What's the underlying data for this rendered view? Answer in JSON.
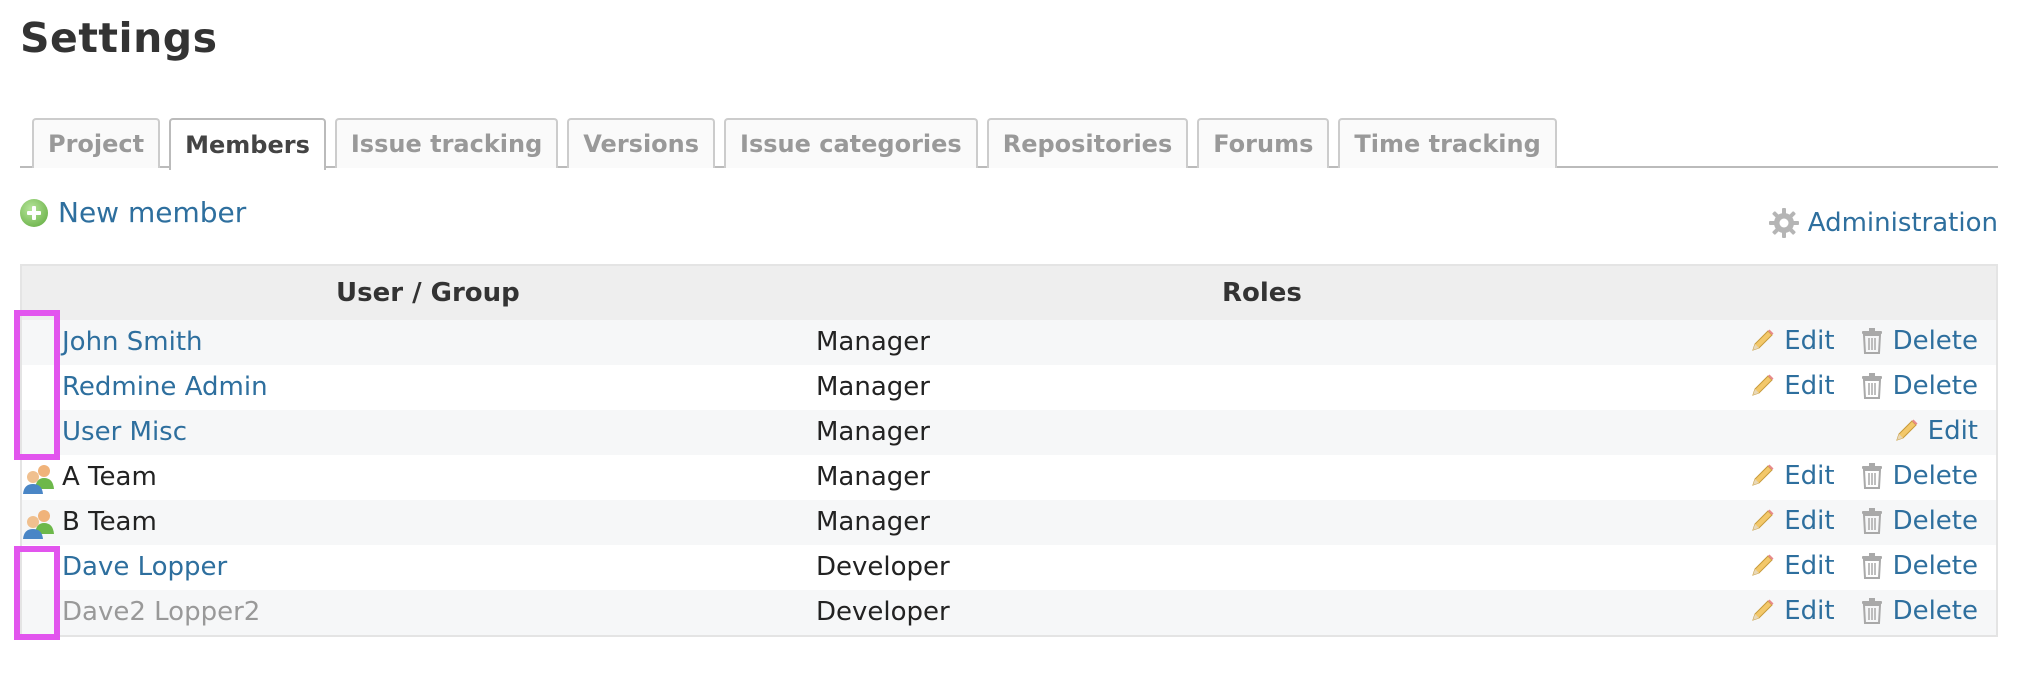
{
  "page": {
    "title": "Settings"
  },
  "tabs": [
    {
      "label": "Project",
      "selected": false
    },
    {
      "label": "Members",
      "selected": true
    },
    {
      "label": "Issue tracking",
      "selected": false
    },
    {
      "label": "Versions",
      "selected": false
    },
    {
      "label": "Issue categories",
      "selected": false
    },
    {
      "label": "Repositories",
      "selected": false
    },
    {
      "label": "Forums",
      "selected": false
    },
    {
      "label": "Time tracking",
      "selected": false
    }
  ],
  "actions_bar": {
    "new_member_label": "New member",
    "new_member_icon": "plus-circle-icon",
    "administration_label": "Administration",
    "administration_icon": "gear-icon"
  },
  "table": {
    "headers": {
      "user_group": "User / Group",
      "roles": "Roles"
    },
    "edit_label": "Edit",
    "delete_label": "Delete",
    "rows": [
      {
        "name": "John Smith",
        "kind": "user",
        "role": "Manager",
        "can_delete": true
      },
      {
        "name": "Redmine Admin",
        "kind": "user",
        "role": "Manager",
        "can_delete": true
      },
      {
        "name": "User Misc",
        "kind": "user",
        "role": "Manager",
        "can_delete": false
      },
      {
        "name": "A Team",
        "kind": "group",
        "role": "Manager",
        "can_delete": true
      },
      {
        "name": "B Team",
        "kind": "group",
        "role": "Manager",
        "can_delete": true
      },
      {
        "name": "Dave Lopper",
        "kind": "user",
        "role": "Developer",
        "can_delete": true
      },
      {
        "name": "Dave2 Lopper2",
        "kind": "locked-user",
        "role": "Developer",
        "can_delete": true
      }
    ]
  },
  "colors": {
    "link": "#2e6f9e",
    "highlight": "#e255ee",
    "locked_text": "#999999"
  }
}
